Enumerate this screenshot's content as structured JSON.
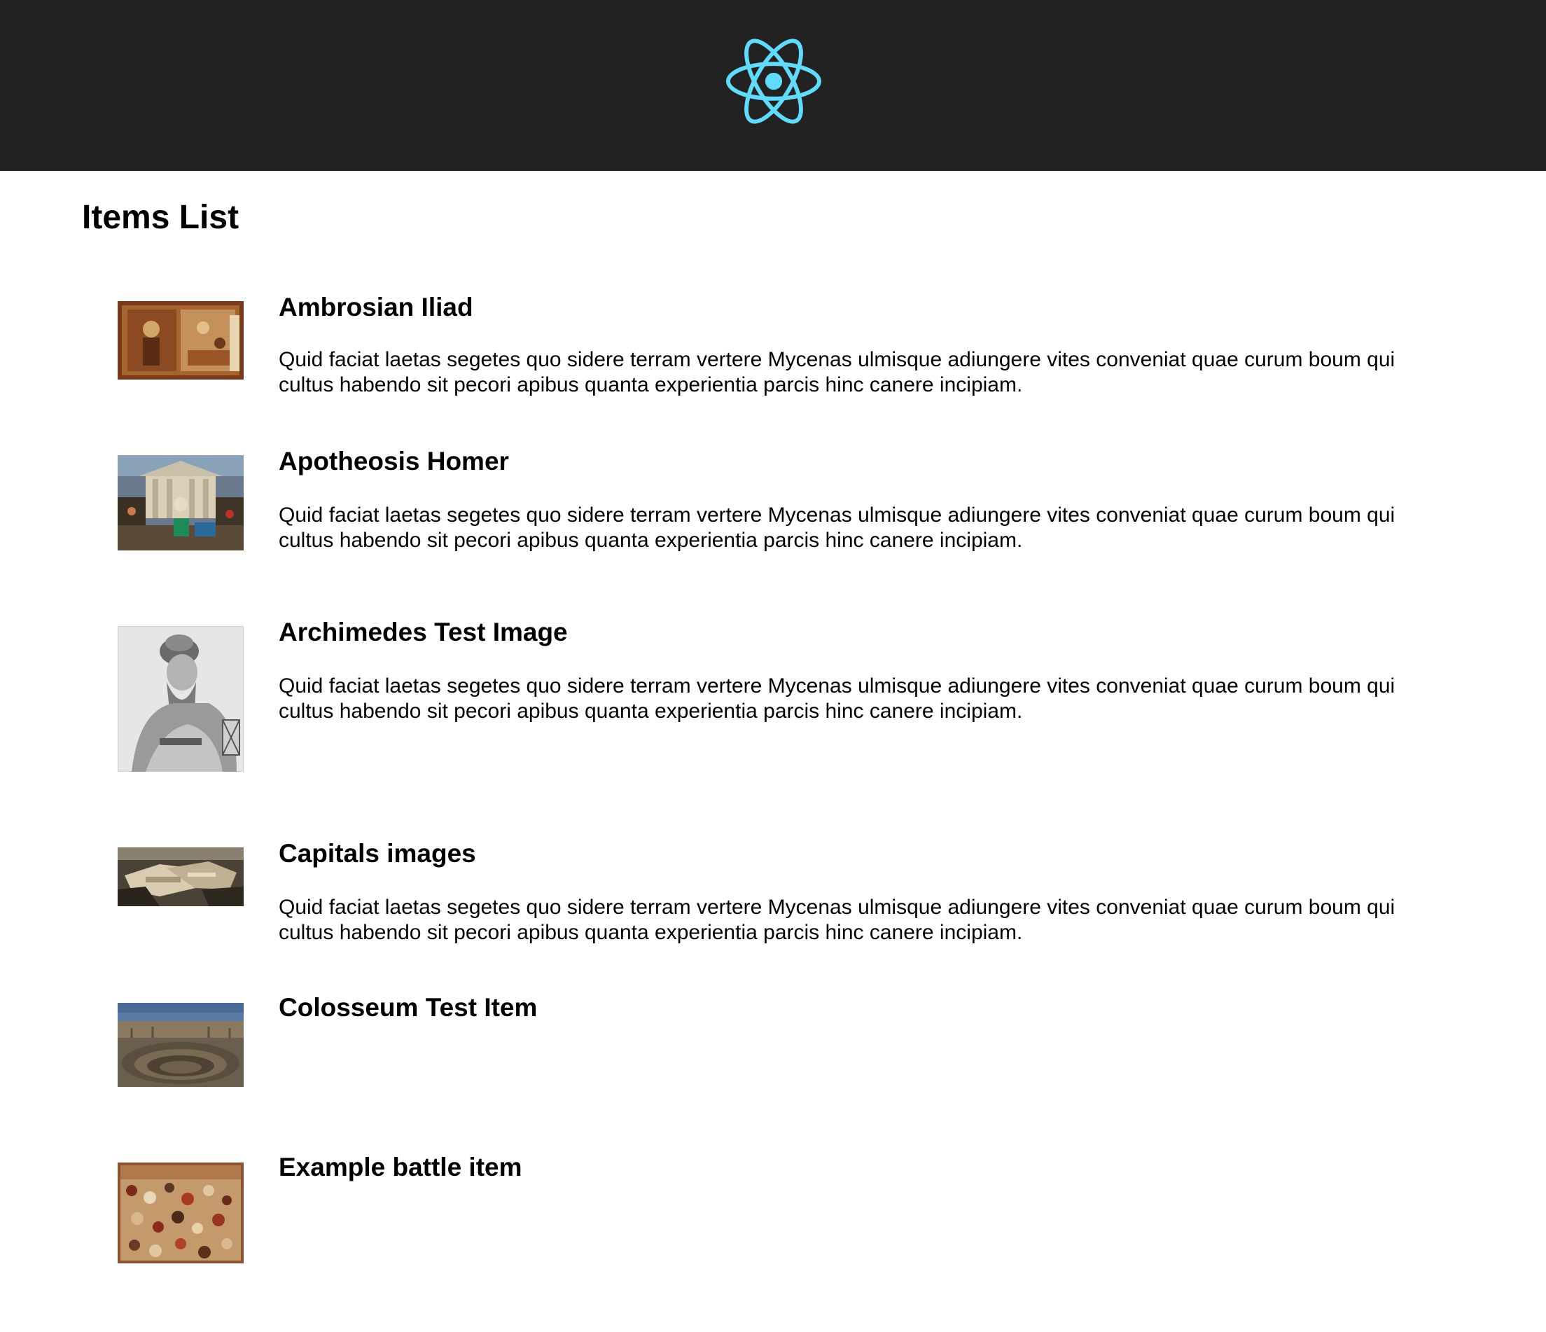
{
  "header": {
    "logo_icon": "react-atom-logo-icon",
    "background": "#222222",
    "logo_color": "#61DAFB"
  },
  "page": {
    "title": "Items List"
  },
  "items": [
    {
      "title": "Ambrosian Iliad",
      "description": "Quid faciat laetas segetes quo sidere terram vertere Mycenas ulmisque adiungere vites conveniat quae curum boum qui cultus habendo sit pecori apibus quanta experientia parcis hinc canere incipiam.",
      "image_alt": "Ambrosian Iliad"
    },
    {
      "title": "Apotheosis Homer",
      "description": "Quid faciat laetas segetes quo sidere terram vertere Mycenas ulmisque adiungere vites conveniat quae curum boum qui cultus habendo sit pecori apibus quanta experientia parcis hinc canere incipiam.",
      "image_alt": "Apotheosis Homer"
    },
    {
      "title": "Archimedes Test Image",
      "description": "Quid faciat laetas segetes quo sidere terram vertere Mycenas ulmisque adiungere vites conveniat quae curum boum qui cultus habendo sit pecori apibus quanta experientia parcis hinc canere incipiam.",
      "image_alt": "Archimedes Test Image"
    },
    {
      "title": "Capitals images",
      "description": "Quid faciat laetas segetes quo sidere terram vertere Mycenas ulmisque adiungere vites conveniat quae curum boum qui cultus habendo sit pecori apibus quanta experientia parcis hinc canere incipiam.",
      "image_alt": "Capitals images"
    },
    {
      "title": "Colosseum Test Item",
      "description": "",
      "image_alt": "Colosseum Test Item"
    },
    {
      "title": "Example battle item",
      "description": "",
      "image_alt": "Example battle item"
    }
  ]
}
